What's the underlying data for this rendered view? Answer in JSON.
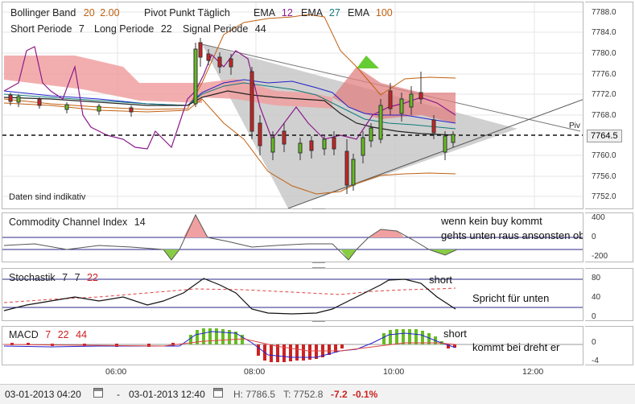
{
  "header": {
    "bollinger_label": "Bollinger Band",
    "bollinger_p1": "20",
    "bollinger_p2": "2.00",
    "pivot_label": "Pivot Punkt Täglich",
    "ema1_label": "EMA",
    "ema1_val": "12",
    "ema2_label": "EMA",
    "ema2_val": "27",
    "ema3_label": "EMA",
    "ema3_val": "100",
    "short_label": "Short Periode",
    "short_val": "7",
    "long_label": "Long Periode",
    "long_val": "22",
    "signal_label": "Signal Periode",
    "signal_val": "44"
  },
  "main": {
    "disclaimer": "Daten sind indikativ",
    "pivot_tag": "Piv",
    "y_ticks": [
      "7788.0",
      "7784.0",
      "7780.0",
      "7776.0",
      "7772.0",
      "7768.0",
      "7764.5",
      "7760.0",
      "7756.0",
      "7752.0"
    ],
    "current_price": "7764.5"
  },
  "cci": {
    "label": "Commodity Channel Index",
    "period": "14",
    "y_ticks": [
      "400",
      "0",
      "-200"
    ],
    "note1": "wenn kein buy kommt",
    "note2": "gehts unten raus ansonsten oben"
  },
  "stoch": {
    "label": "Stochastik",
    "p1": "7",
    "p2": "7",
    "p3": "22",
    "y_ticks": [
      "80",
      "40",
      "0"
    ],
    "note_short": "short",
    "note_down": "Spricht für unten"
  },
  "macd": {
    "label": "MACD",
    "p1": "7",
    "p2": "22",
    "p3": "44",
    "y_ticks": [
      "0",
      "-4"
    ],
    "note_short": "short",
    "note_turn": "kommt bei dreht er"
  },
  "x_ticks": [
    "06:00",
    "08:00",
    "10:00",
    "12:00"
  ],
  "footer": {
    "from": "03-01-2013 04:20",
    "dash": "-",
    "to": "03-01-2013 12:40",
    "high": "H: 7786.5",
    "low": "T: 7752.8",
    "change": "-7.2",
    "change_pct": "-0.1%"
  },
  "colors": {
    "up_candle": "#66bb22",
    "down_candle": "#cc2222",
    "cloud_red": "#f0a0a0",
    "cloud_green": "#66cc33",
    "triangle": "#c8c8c8"
  }
}
